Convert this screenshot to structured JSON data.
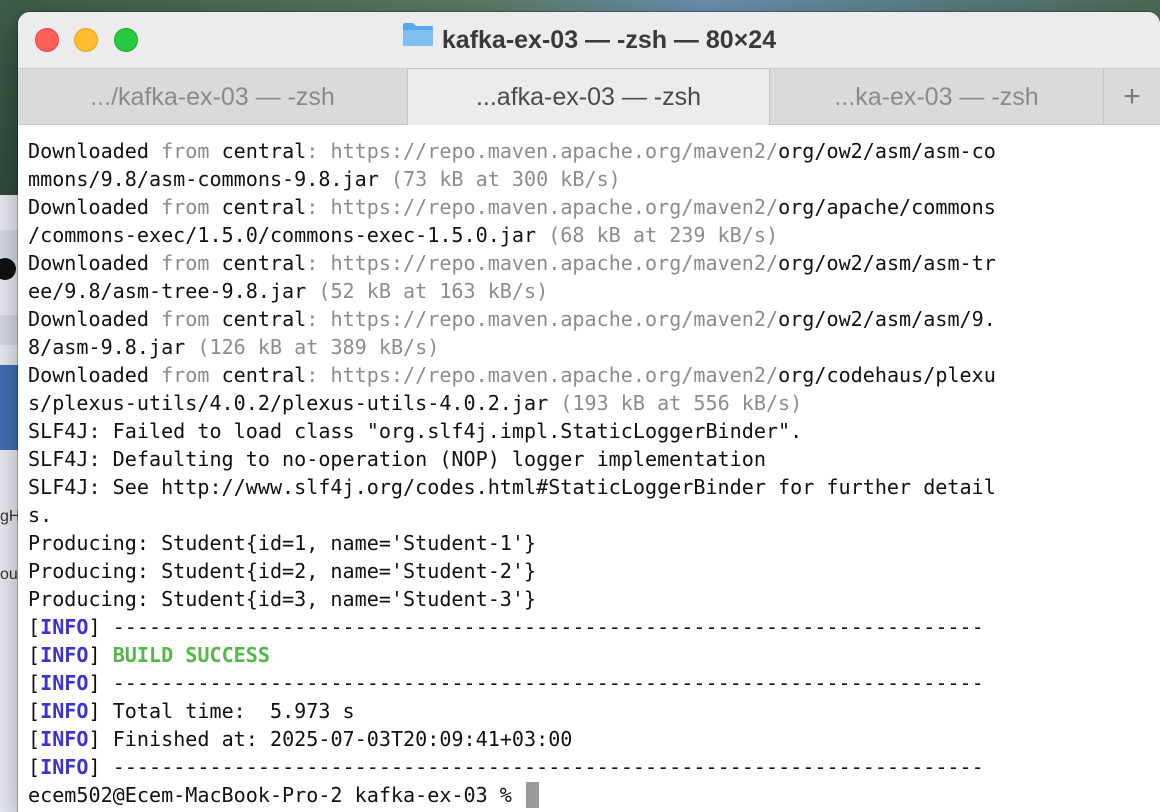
{
  "window": {
    "title": "kafka-ex-03 — -zsh — 80×24",
    "folder_icon": "folder-icon",
    "title_color": "#3a3a3a"
  },
  "tabs": [
    {
      "label": ".../kafka-ex-03 — -zsh",
      "active": false
    },
    {
      "label": "...afka-ex-03 — -zsh",
      "active": true
    },
    {
      "label": "...ka-ex-03 — -zsh",
      "active": false
    }
  ],
  "new_tab_label": "+",
  "colors": {
    "info": "#3b33d0",
    "success": "#54b848",
    "dim": "#8c8c8c",
    "close": "#ff5f57",
    "minimize": "#febc2e",
    "maximize": "#28c840"
  },
  "terminal": {
    "downloads": [
      {
        "word": "Downloaded",
        "from": " from ",
        "repo": "central",
        "colon": ": ",
        "base_url": "https://repo.maven.apache.org/maven2/",
        "line1_path": "org/ow2/asm/asm-co",
        "line2_path": "mmons/9.8/asm-commons-9.8.jar",
        "stats": " (73 kB at 300 kB/s)"
      },
      {
        "word": "Downloaded",
        "from": " from ",
        "repo": "central",
        "colon": ": ",
        "base_url": "https://repo.maven.apache.org/maven2/",
        "line1_path": "org/apache/commons",
        "line2_path": "/commons-exec/1.5.0/commons-exec-1.5.0.jar",
        "stats": " (68 kB at 239 kB/s)"
      },
      {
        "word": "Downloaded",
        "from": " from ",
        "repo": "central",
        "colon": ": ",
        "base_url": "https://repo.maven.apache.org/maven2/",
        "line1_path": "org/ow2/asm/asm-tr",
        "line2_path": "ee/9.8/asm-tree-9.8.jar",
        "stats": " (52 kB at 163 kB/s)"
      },
      {
        "word": "Downloaded",
        "from": " from ",
        "repo": "central",
        "colon": ": ",
        "base_url": "https://repo.maven.apache.org/maven2/",
        "line1_path": "org/ow2/asm/asm/9.",
        "line2_path": "8/asm-9.8.jar",
        "stats": " (126 kB at 389 kB/s)"
      },
      {
        "word": "Downloaded",
        "from": " from ",
        "repo": "central",
        "colon": ": ",
        "base_url": "https://repo.maven.apache.org/maven2/",
        "line1_path": "org/codehaus/plexu",
        "line2_path": "s/plexus-utils/4.0.2/plexus-utils-4.0.2.jar",
        "stats": " (193 kB at 556 kB/s)"
      }
    ],
    "slf4j": [
      "SLF4J: Failed to load class \"org.slf4j.impl.StaticLoggerBinder\".",
      "SLF4J: Defaulting to no-operation (NOP) logger implementation",
      "SLF4J: See http://www.slf4j.org/codes.html#StaticLoggerBinder for further detail",
      "s."
    ],
    "producing": [
      "Producing: Student{id=1, name='Student-1'}",
      "Producing: Student{id=2, name='Student-2'}",
      "Producing: Student{id=3, name='Student-3'}"
    ],
    "info_tag": "INFO",
    "separator": "------------------------------------------------------------------------",
    "build_success": "BUILD SUCCESS",
    "total_time": "Total time:  5.973 s",
    "finished_at": "Finished at: 2025-07-03T20:09:41+03:00",
    "prompt": "ecem502@Ecem-MacBook-Pro-2 kafka-ex-03 % "
  },
  "background_fragments": {
    "left_text_1": "gH",
    "left_text_2": "ou"
  }
}
